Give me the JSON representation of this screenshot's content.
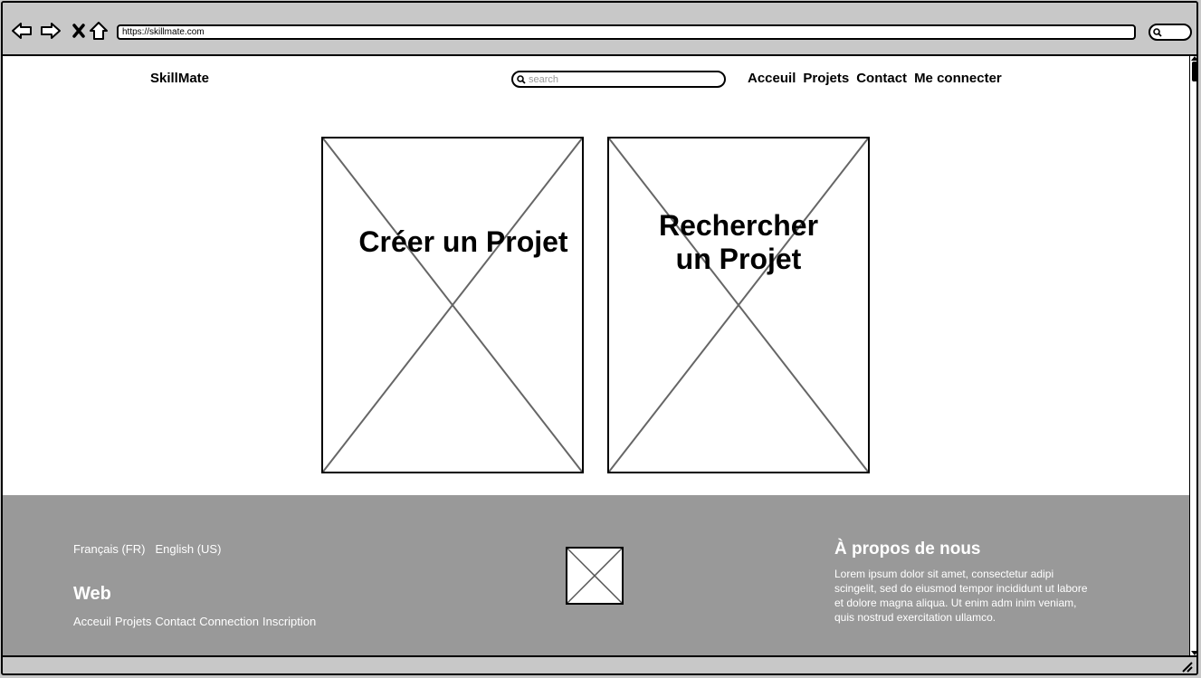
{
  "browser": {
    "url": "https://skillmate.com"
  },
  "header": {
    "brand": "SkillMate",
    "search_placeholder": "search",
    "nav": [
      "Acceuil",
      "Projets",
      "Contact",
      "Me connecter"
    ]
  },
  "cards": [
    {
      "title": "Créer un Projet"
    },
    {
      "title_line1": "Rechercher",
      "title_line2": "un Projet"
    }
  ],
  "footer": {
    "languages": [
      "Français (FR)",
      "English (US)"
    ],
    "web_title": "Web",
    "web_links": [
      "Acceuil",
      "Projets",
      "Contact",
      "Connection",
      "Inscription"
    ],
    "about_title": "À propos de nous",
    "about_text": "Lorem ipsum dolor sit amet, consectetur adipi scingelit, sed do eiusmod tempor incididunt ut labore et dolore magna aliqua. Ut enim adm inim veniam, quis nostrud exercitation ullamco."
  }
}
